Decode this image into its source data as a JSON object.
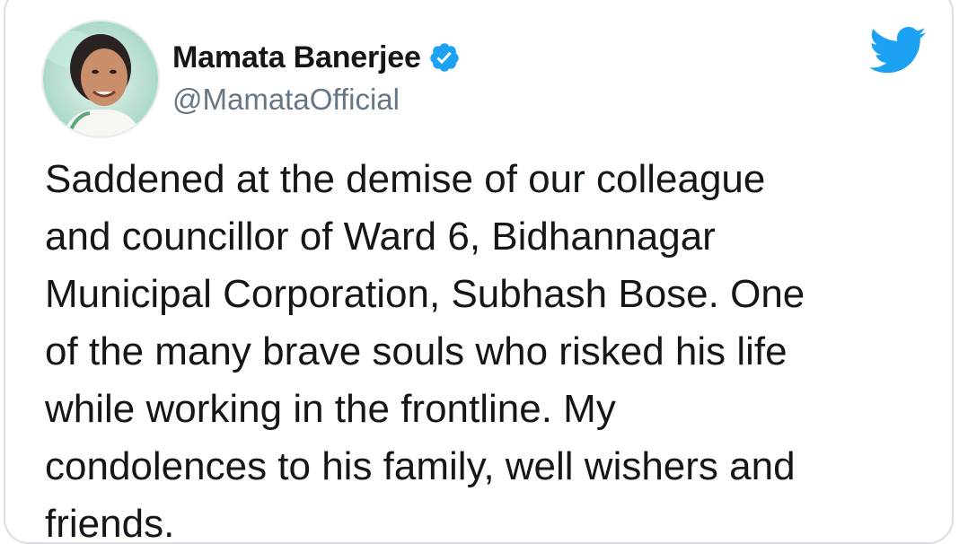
{
  "tweet": {
    "author": {
      "display_name": "Mamata Banerjee",
      "handle": "@MamataOfficial",
      "verified": true,
      "verified_icon": "verified-badge-icon"
    },
    "platform_icon": "twitter-bird-icon",
    "text_lines": [
      "Saddened at the demise of our colleague",
      "and councillor of Ward 6, Bidhannagar",
      "Municipal Corporation, Subhash Bose. One",
      "of the many brave souls who risked his life",
      "while working in the frontline. My",
      "condolences to his family, well wishers and",
      "friends."
    ]
  },
  "colors": {
    "twitter_blue": "#1da1f2",
    "text": "#14171a",
    "secondary_text": "#657786",
    "border": "#d9dde1"
  }
}
